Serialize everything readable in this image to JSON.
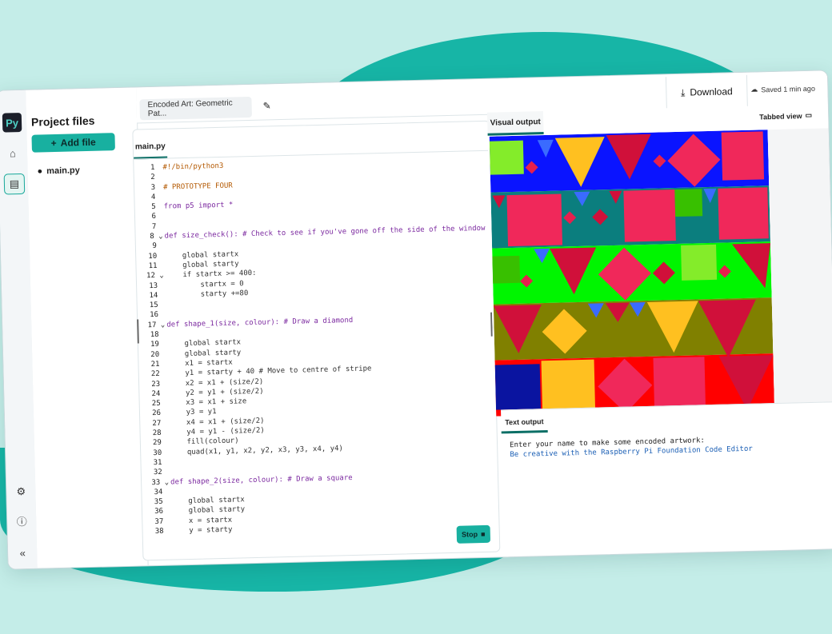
{
  "colors": {
    "background": "#c4ede8",
    "blob": "#17b5a6",
    "accent": "#18b0a0"
  },
  "rail": {
    "icons": [
      "python-logo-icon",
      "home-icon",
      "files-icon",
      "settings-icon",
      "info-icon",
      "collapse-icon"
    ]
  },
  "project": {
    "title": "Project files",
    "add_file": "Add file",
    "files": [
      {
        "name": "main.py"
      }
    ]
  },
  "topbar": {
    "project_name": "Encoded Art: Geometric Pat...",
    "download": "Download",
    "saved": "Saved 1 min ago"
  },
  "editor": {
    "tab": "main.py",
    "run_button": "Stop",
    "lines": [
      {
        "n": "1",
        "t": "#!/bin/python3"
      },
      {
        "n": "2",
        "t": ""
      },
      {
        "n": "3",
        "t": "# PROTOTYPE FOUR"
      },
      {
        "n": "4",
        "t": ""
      },
      {
        "n": "5",
        "t": "from p5 import *"
      },
      {
        "n": "6",
        "t": ""
      },
      {
        "n": "7",
        "t": ""
      },
      {
        "n": "8",
        "t": "def size_check(): # Check to see if you've gone off the side of the window"
      },
      {
        "n": "9",
        "t": ""
      },
      {
        "n": "10",
        "t": "    global startx"
      },
      {
        "n": "11",
        "t": "    global starty"
      },
      {
        "n": "12",
        "t": "    if startx >= 400:"
      },
      {
        "n": "13",
        "t": "        startx = 0"
      },
      {
        "n": "14",
        "t": "        starty +=80"
      },
      {
        "n": "15",
        "t": ""
      },
      {
        "n": "16",
        "t": ""
      },
      {
        "n": "17",
        "t": "def shape_1(size, colour): # Draw a diamond"
      },
      {
        "n": "18",
        "t": ""
      },
      {
        "n": "19",
        "t": "    global startx"
      },
      {
        "n": "20",
        "t": "    global starty"
      },
      {
        "n": "21",
        "t": "    x1 = startx"
      },
      {
        "n": "22",
        "t": "    y1 = starty + 40 # Move to centre of stripe"
      },
      {
        "n": "23",
        "t": "    x2 = x1 + (size/2)"
      },
      {
        "n": "24",
        "t": "    y2 = y1 + (size/2)"
      },
      {
        "n": "25",
        "t": "    x3 = x1 + size"
      },
      {
        "n": "26",
        "t": "    y3 = y1"
      },
      {
        "n": "27",
        "t": "    x4 = x1 + (size/2)"
      },
      {
        "n": "28",
        "t": "    y4 = y1 - (size/2)"
      },
      {
        "n": "29",
        "t": "    fill(colour)"
      },
      {
        "n": "30",
        "t": "    quad(x1, y1, x2, y2, x3, y3, x4, y4)"
      },
      {
        "n": "31",
        "t": ""
      },
      {
        "n": "32",
        "t": ""
      },
      {
        "n": "33",
        "t": "def shape_2(size, colour): # Draw a square"
      },
      {
        "n": "34",
        "t": ""
      },
      {
        "n": "35",
        "t": "    global startx"
      },
      {
        "n": "36",
        "t": "    global starty"
      },
      {
        "n": "37",
        "t": "    x = startx"
      },
      {
        "n": "38",
        "t": "    y = starty"
      }
    ]
  },
  "visual": {
    "tab": "Visual output",
    "tabbed_view": "Tabbed view"
  },
  "text_output": {
    "tab": "Text output",
    "line1": "Enter your name to make some encoded artwork:",
    "line2": "Be creative with the Raspberry Pi Foundation Code Editor"
  }
}
